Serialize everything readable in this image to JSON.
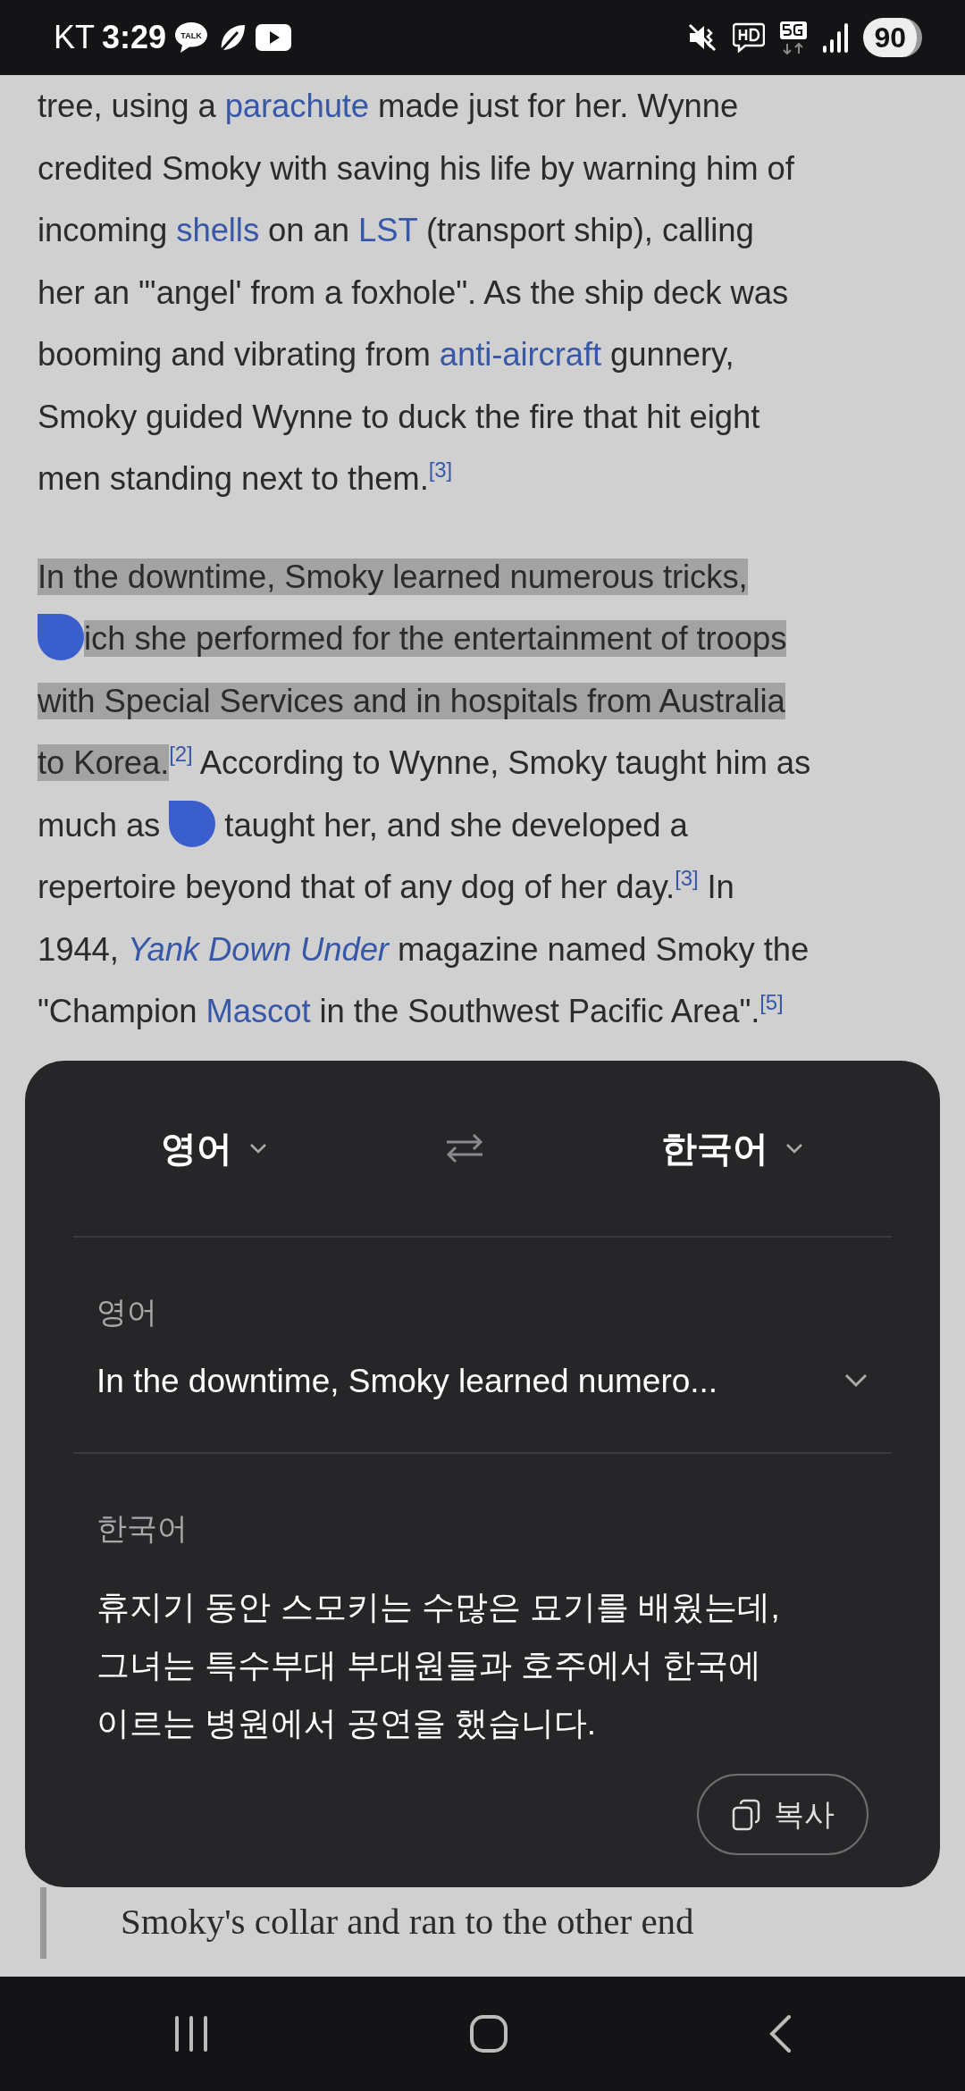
{
  "status_bar": {
    "carrier": "KT",
    "time": "3:29",
    "talk_icon_text": "TALK",
    "battery": "90"
  },
  "article": {
    "paragraphs": [
      {
        "lines": [
          [
            {
              "kind": "text",
              "text": "tree, using a "
            },
            {
              "kind": "link",
              "text": "parachute"
            },
            {
              "kind": "text",
              "text": " made just for her. Wynne"
            }
          ],
          [
            {
              "kind": "text",
              "text": "credited Smoky with saving his life by warning him of"
            }
          ],
          [
            {
              "kind": "text",
              "text": "incoming "
            },
            {
              "kind": "link",
              "text": "shells"
            },
            {
              "kind": "text",
              "text": " on an "
            },
            {
              "kind": "link",
              "text": "LST"
            },
            {
              "kind": "text",
              "text": " (transport ship), calling"
            }
          ],
          [
            {
              "kind": "text",
              "text": "her an \"'angel' from a foxhole\". As the ship deck was"
            }
          ],
          [
            {
              "kind": "text",
              "text": "booming and vibrating from "
            },
            {
              "kind": "link",
              "text": "anti-aircraft"
            },
            {
              "kind": "text",
              "text": " gunnery,"
            }
          ],
          [
            {
              "kind": "text",
              "text": "Smoky guided Wynne to duck the fire that hit eight"
            }
          ],
          [
            {
              "kind": "text",
              "text": "men standing next to them."
            },
            {
              "kind": "cite",
              "text": "[3]"
            }
          ]
        ]
      },
      {
        "lines": [
          [
            {
              "kind": "text",
              "text": "In the downtime, Smoky learned numerous tricks,",
              "selected": true
            }
          ],
          [
            {
              "kind": "handle"
            },
            {
              "kind": "text",
              "text": "ich she performed for the entertainment of troops",
              "selected": true
            }
          ],
          [
            {
              "kind": "text",
              "text": "with Special Services and in hospitals from Australia",
              "selected": true
            }
          ],
          [
            {
              "kind": "text",
              "text": "to Korea.",
              "selected": true
            },
            {
              "kind": "cite",
              "text": "[2]"
            },
            {
              "kind": "text",
              "text": " According to Wynne, Smoky taught him as"
            }
          ],
          [
            {
              "kind": "text",
              "text": "much as "
            },
            {
              "kind": "handle"
            },
            {
              "kind": "text",
              "text": " taught her, and she developed a"
            }
          ],
          [
            {
              "kind": "text",
              "text": "repertoire beyond that of any dog of her day."
            },
            {
              "kind": "cite",
              "text": "[3]"
            },
            {
              "kind": "text",
              "text": " In"
            }
          ],
          [
            {
              "kind": "text",
              "text": "1944, "
            },
            {
              "kind": "italic-link",
              "text": "Yank Down Under"
            },
            {
              "kind": "text",
              "text": " magazine named Smoky the"
            }
          ],
          [
            {
              "kind": "text",
              "text": "\"Champion "
            },
            {
              "kind": "link",
              "text": "Mascot"
            },
            {
              "kind": "text",
              "text": " in the Southwest Pacific Area\"."
            },
            {
              "kind": "cite",
              "text": "[5]"
            }
          ]
        ]
      }
    ],
    "quote_line": "Smoky's collar and ran to the other end"
  },
  "translate_sheet": {
    "source_language": "영어",
    "target_language": "한국어",
    "source_label": "영어",
    "source_text": "In the downtime, Smoky learned numero...",
    "target_label": "한국어",
    "target_lines": [
      "휴지기 동안 스모키는 수많은 묘기를 배웠는데,",
      "그녀는 특수부대 부대원들과 호주에서 한국에",
      "이르는 병원에서 공연을 했습니다."
    ],
    "copy_button": "복사"
  }
}
